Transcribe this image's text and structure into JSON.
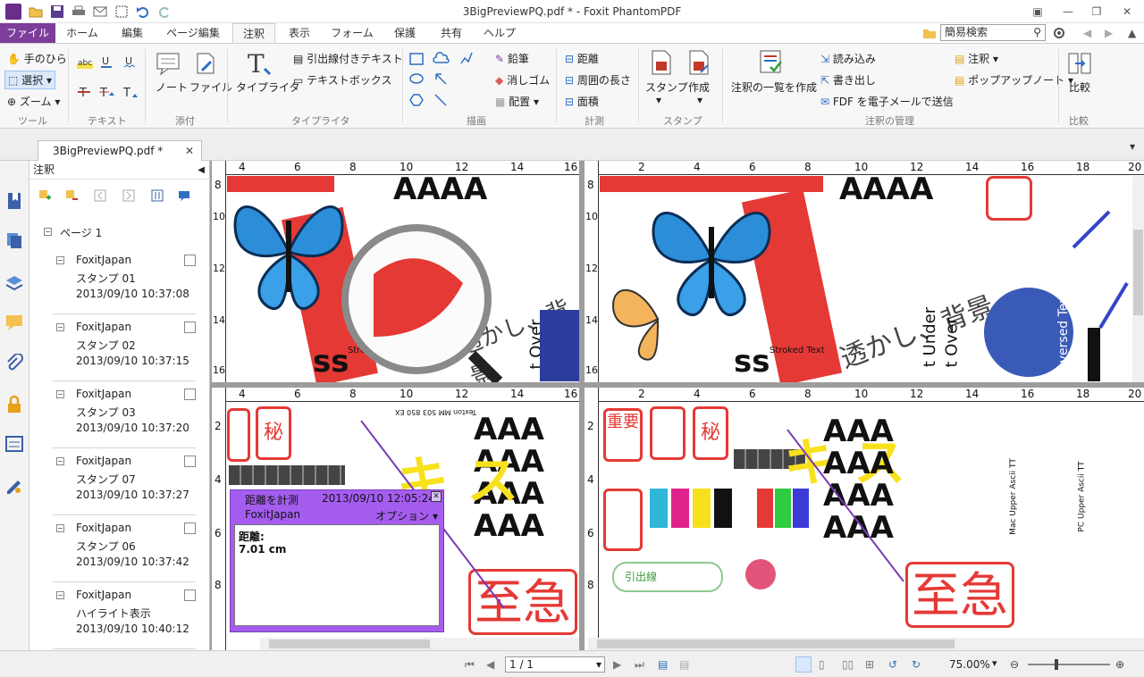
{
  "window": {
    "title": "3BigPreviewPQ.pdf * - Foxit PhantomPDF"
  },
  "tabs": [
    "ファイル",
    "ホーム",
    "編集",
    "ページ編集",
    "注釈",
    "表示",
    "フォーム",
    "保護",
    "共有",
    "ヘルプ"
  ],
  "search": {
    "placeholder": "簡易検索"
  },
  "ribbon": {
    "tools": {
      "hand": "手のひら",
      "select": "選択",
      "zoom": "ズーム",
      "label": "ツール"
    },
    "text": {
      "label": "テキスト"
    },
    "attach": {
      "note": "ノート",
      "file": "ファイル",
      "label": "添付"
    },
    "typewriter": {
      "tw": "タイプライタ",
      "callout": "引出線付きテキスト",
      "textbox": "テキストボックス",
      "label": "タイプライタ"
    },
    "drawing": {
      "pencil": "鉛筆",
      "eraser": "消しゴム",
      "arrange": "配置",
      "label": "描画"
    },
    "measure": {
      "distance": "距離",
      "perimeter": "周囲の長さ",
      "area": "面積",
      "label": "計測"
    },
    "stamp": {
      "stamp": "スタンプ",
      "create": "作成",
      "label": "スタンプ"
    },
    "manage": {
      "summarize": "注釈の一覧を作成",
      "import": "読み込み",
      "export": "書き出し",
      "fdf": "FDF を電子メールで送信",
      "annot": "注釈",
      "popup": "ポップアップノート",
      "label": "注釈の管理"
    },
    "compare": {
      "compare": "比較",
      "label": "比較"
    }
  },
  "doc_tab": {
    "name": "3BigPreviewPQ.pdf *"
  },
  "panel": {
    "title": "注釈",
    "page": "ページ 1",
    "items": [
      {
        "author": "FoxitJapan",
        "type": "スタンプ 01",
        "date": "2013/09/10 10:37:08"
      },
      {
        "author": "FoxitJapan",
        "type": "スタンプ 02",
        "date": "2013/09/10 10:37:15"
      },
      {
        "author": "FoxitJapan",
        "type": "スタンプ 03",
        "date": "2013/09/10 10:37:20"
      },
      {
        "author": "FoxitJapan",
        "type": "スタンプ 07",
        "date": "2013/09/10 10:37:27"
      },
      {
        "author": "FoxitJapan",
        "type": "スタンプ 06",
        "date": "2013/09/10 10:37:42"
      },
      {
        "author": "FoxitJapan",
        "type": "ハイライト表示",
        "date": "2013/09/10 10:40:12"
      }
    ]
  },
  "document": {
    "texts": {
      "watermark": "透かし、背景",
      "kanji_big": "至急",
      "katakana": "キ ス",
      "secret": "秘",
      "important": "重要",
      "callout": "引出線",
      "stroked": "Stroked Text",
      "under": "t Under",
      "over": "t Over",
      "reversed": "Reversed Text",
      "ss": "ss",
      "mac_upper": "Mac Upper Ascii TT",
      "pc_upper": "PC Upper Ascii TT",
      "texton": "Texton MM 503 850 EX"
    }
  },
  "popup_note": {
    "title": "距離を計測",
    "date": "2013/09/10 12:05:24",
    "author": "FoxitJapan",
    "options": "オプション",
    "label": "距離:",
    "value": "7.01 cm"
  },
  "status": {
    "page": "1 / 1",
    "zoom": "75.00%"
  }
}
